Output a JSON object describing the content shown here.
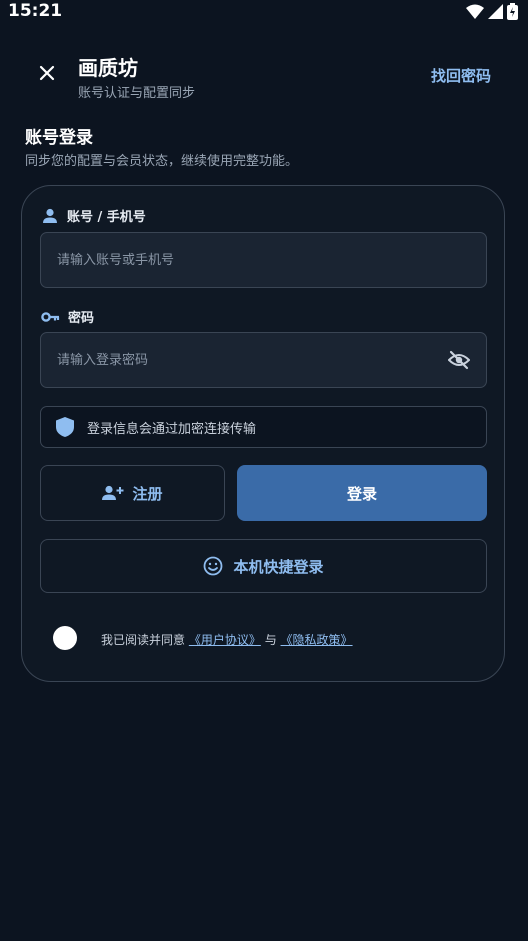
{
  "status": {
    "time": "15:21"
  },
  "header": {
    "title": "画质坊",
    "subtitle": "账号认证与配置同步",
    "forgot_label": "找回密码"
  },
  "section": {
    "title": "账号登录",
    "description": "同步您的配置与会员状态，继续使用完整功能。"
  },
  "form": {
    "account": {
      "label": "账号 / 手机号",
      "placeholder": "请输入账号或手机号",
      "icon": "person-icon"
    },
    "password": {
      "label": "密码",
      "placeholder": "请输入登录密码",
      "icon": "key-icon"
    },
    "notice": "登录信息会通过加密连接传输",
    "register_label": "注册",
    "login_label": "登录",
    "quick_login_label": "本机快捷登录"
  },
  "agreement": {
    "prefix": "我已阅读并同意",
    "user_agreement": "《用户协议》",
    "joiner": "与",
    "privacy_policy": "《隐私政策》"
  },
  "colors": {
    "background": "#0c1420",
    "accent": "#8fbdf0",
    "primary_button": "#3a6ba8",
    "border": "#3a4554"
  }
}
